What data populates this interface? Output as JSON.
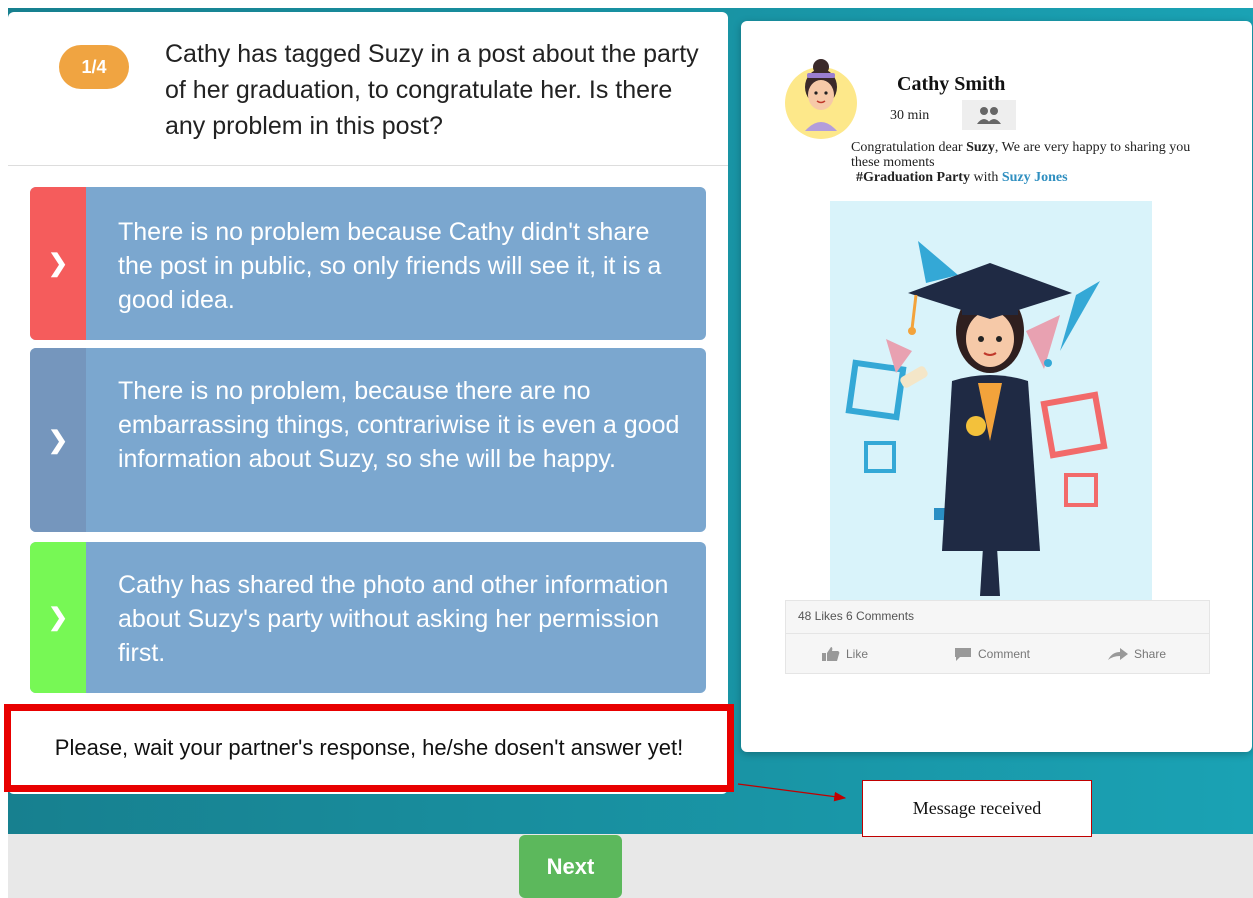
{
  "quiz": {
    "progress": "1/4",
    "question": "Cathy has tagged Suzy in a post about the party of her graduation, to congratulate her. Is there any problem in this post?",
    "options": [
      {
        "text": "There is no problem because Cathy didn't share the post in public, so only friends will see it, it is a good idea.",
        "indicator_color": "#f55c5c"
      },
      {
        "text": "There is no problem, because there are no embarrassing things, contrariwise it is even a good information about Suzy, so she will be happy.",
        "indicator_color": "#7596bd"
      },
      {
        "text": "Cathy has shared the photo and other information about Suzy's party without asking her permission first.",
        "indicator_color": "#77f855"
      }
    ],
    "wait_message": "Please, wait your partner's response, he/she dosen't answer yet!"
  },
  "post": {
    "author": "Cathy Smith",
    "time": "30 min",
    "text_part1": "Congratulation dear ",
    "text_bold1": "Suzy",
    "text_part2": ", We are very happy to sharing you these moments",
    "hashtag": "#Graduation Party",
    "with_word": " with ",
    "tagged": "Suzy Jones",
    "stats": "48 Likes  6 Comments",
    "actions": {
      "like": "Like",
      "comment": "Comment",
      "share": "Share"
    }
  },
  "annotation": {
    "label": "Message received"
  },
  "footer": {
    "next_label": "Next"
  },
  "colors": {
    "teal": "#1aa2b4",
    "badge": "#f0a441",
    "option_bg": "#7ba7cf",
    "next": "#5cb85c",
    "highlight": "#e80000"
  }
}
